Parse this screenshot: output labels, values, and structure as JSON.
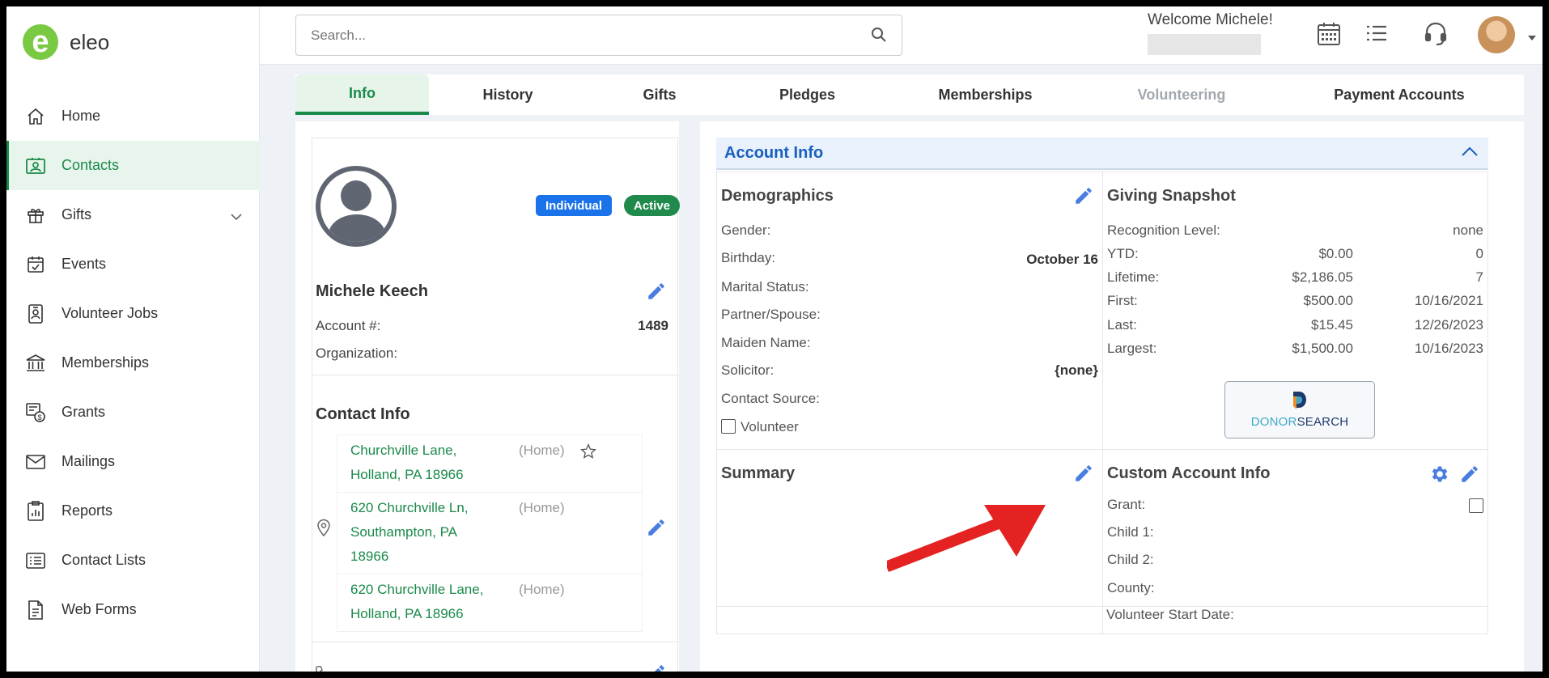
{
  "app": {
    "name": "eleo"
  },
  "sidebar": {
    "items": [
      {
        "label": "Home",
        "icon": "home-icon"
      },
      {
        "label": "Contacts",
        "icon": "contact-card-icon",
        "active": true
      },
      {
        "label": "Gifts",
        "icon": "gift-icon",
        "expandable": true
      },
      {
        "label": "Events",
        "icon": "calendar-check-icon"
      },
      {
        "label": "Volunteer Jobs",
        "icon": "badge-icon"
      },
      {
        "label": "Memberships",
        "icon": "institution-icon"
      },
      {
        "label": "Grants",
        "icon": "grant-icon"
      },
      {
        "label": "Mailings",
        "icon": "envelope-icon"
      },
      {
        "label": "Reports",
        "icon": "report-icon"
      },
      {
        "label": "Contact Lists",
        "icon": "list-icon"
      },
      {
        "label": "Web Forms",
        "icon": "form-icon"
      }
    ]
  },
  "header": {
    "search_placeholder": "Search...",
    "welcome": "Welcome Michele!"
  },
  "tabs": [
    {
      "label": "Info",
      "state": "active"
    },
    {
      "label": "History",
      "state": "normal"
    },
    {
      "label": "Gifts",
      "state": "normal"
    },
    {
      "label": "Pledges",
      "state": "normal"
    },
    {
      "label": "Memberships",
      "state": "normal"
    },
    {
      "label": "Volunteering",
      "state": "disabled"
    },
    {
      "label": "Payment Accounts",
      "state": "normal"
    }
  ],
  "profile": {
    "badge_type": "Individual",
    "badge_status": "Active",
    "name": "Michele Keech",
    "account_label": "Account #:",
    "account_value": "1489",
    "organization_label": "Organization:",
    "contact_info_title": "Contact Info",
    "addresses": [
      {
        "lines": [
          "Churchville Lane,",
          "Holland, PA 18966"
        ],
        "label": "(Home)",
        "starred": true
      },
      {
        "lines": [
          "620 Churchville Ln,",
          "Southampton, PA",
          "18966"
        ],
        "label": "(Home)",
        "starred": false
      },
      {
        "lines": [
          "620 Churchville Lane,",
          "Holland, PA 18966"
        ],
        "label": "(Home)",
        "starred": false
      }
    ]
  },
  "account_info": {
    "title": "Account Info",
    "demographics": {
      "title": "Demographics",
      "gender_label": "Gender:",
      "birthday_label": "Birthday:",
      "birthday_value": "October 16",
      "marital_label": "Marital Status:",
      "partner_label": "Partner/Spouse:",
      "maiden_label": "Maiden Name:",
      "solicitor_label": "Solicitor:",
      "solicitor_value": "{none}",
      "source_label": "Contact Source:",
      "volunteer_label": "Volunteer"
    },
    "giving": {
      "title": "Giving Snapshot",
      "recognition_label": "Recognition Level:",
      "recognition_value": "none",
      "rows": [
        {
          "label": "YTD:",
          "amount": "$0.00",
          "extra": "0"
        },
        {
          "label": "Lifetime:",
          "amount": "$2,186.05",
          "extra": "7"
        },
        {
          "label": "First:",
          "amount": "$500.00",
          "extra": "10/16/2021"
        },
        {
          "label": "Last:",
          "amount": "$15.45",
          "extra": "12/26/2023"
        },
        {
          "label": "Largest:",
          "amount": "$1,500.00",
          "extra": "10/16/2023"
        }
      ],
      "donor_search_1": "DONOR",
      "donor_search_2": "SEARCH"
    },
    "summary": {
      "title": "Summary"
    },
    "custom": {
      "title": "Custom Account Info",
      "grant_label": "Grant:",
      "child1_label": "Child 1:",
      "child2_label": "Child 2:",
      "county_label": "County:",
      "vol_start_label": "Volunteer Start Date:"
    }
  },
  "colors": {
    "brand_green": "#1a8a4a",
    "accent_blue": "#1a73e8",
    "annotation_arrow": "#e52222"
  }
}
